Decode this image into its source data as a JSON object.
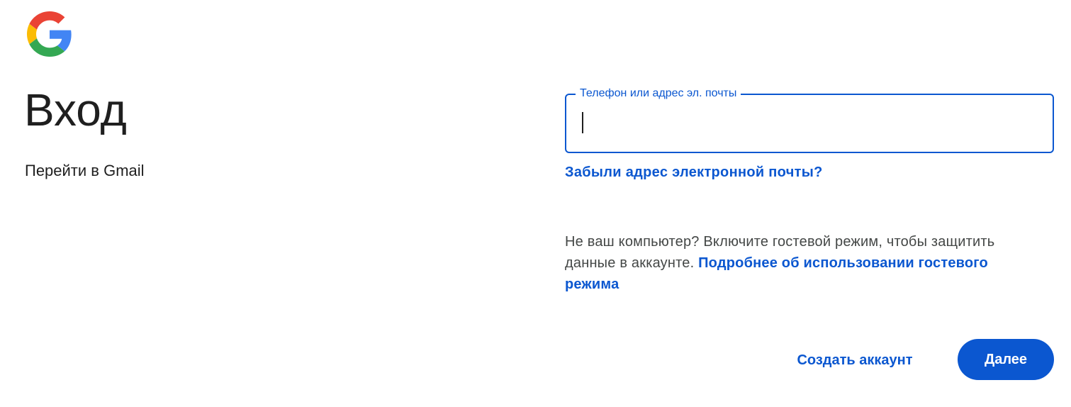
{
  "logo": {
    "icon": "google-g-icon",
    "colors": [
      "#4285F4",
      "#EA4335",
      "#FBBC05",
      "#34A853"
    ]
  },
  "heading": {
    "title": "Вход",
    "subtitle": "Перейти в Gmail"
  },
  "form": {
    "email_field": {
      "label": "Телефон или адрес эл. почты",
      "value": ""
    },
    "forgot_link": "Забыли адрес электронной почты?",
    "guest_text": "Не ваш компьютер? Включите гостевой режим, чтобы защитить данные в аккаунте.",
    "guest_link": "Подробнее об использовании гостевого режима"
  },
  "actions": {
    "create_account": "Создать аккаунт",
    "next": "Далее"
  },
  "colors": {
    "accent": "#0b57d0",
    "text": "#1f1f1f",
    "secondary_text": "#444746",
    "background": "#ffffff"
  }
}
